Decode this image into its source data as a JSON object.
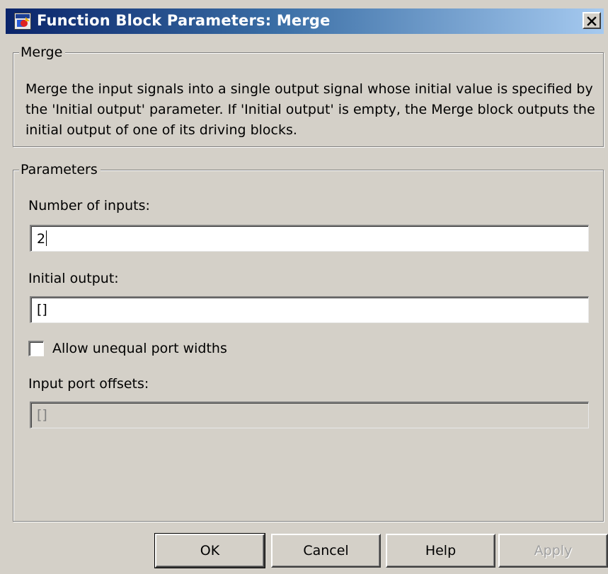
{
  "window": {
    "title": "Function Block Parameters: Merge"
  },
  "description_group": {
    "legend": "Merge",
    "text": "Merge the input signals into a single output signal whose initial value is specified by the 'Initial output' parameter. If 'Initial output' is empty, the Merge block outputs the initial output of one of its driving blocks."
  },
  "parameters_group": {
    "legend": "Parameters",
    "number_of_inputs": {
      "label": "Number of inputs:",
      "value": "2"
    },
    "initial_output": {
      "label": "Initial output:",
      "value": "[]"
    },
    "allow_unequal_port_widths": {
      "label": "Allow unequal port widths",
      "checked": false
    },
    "input_port_offsets": {
      "label": "Input port offsets:",
      "value": "[]",
      "enabled": false
    }
  },
  "buttons": {
    "ok": "OK",
    "cancel": "Cancel",
    "help": "Help",
    "apply": "Apply"
  },
  "colors": {
    "title_bar_start": "#0a246a",
    "title_bar_end": "#a6caf0",
    "dialog_face": "#d4d0c8"
  },
  "icons": {
    "window": "simulink-block-icon",
    "close": "close-icon"
  }
}
